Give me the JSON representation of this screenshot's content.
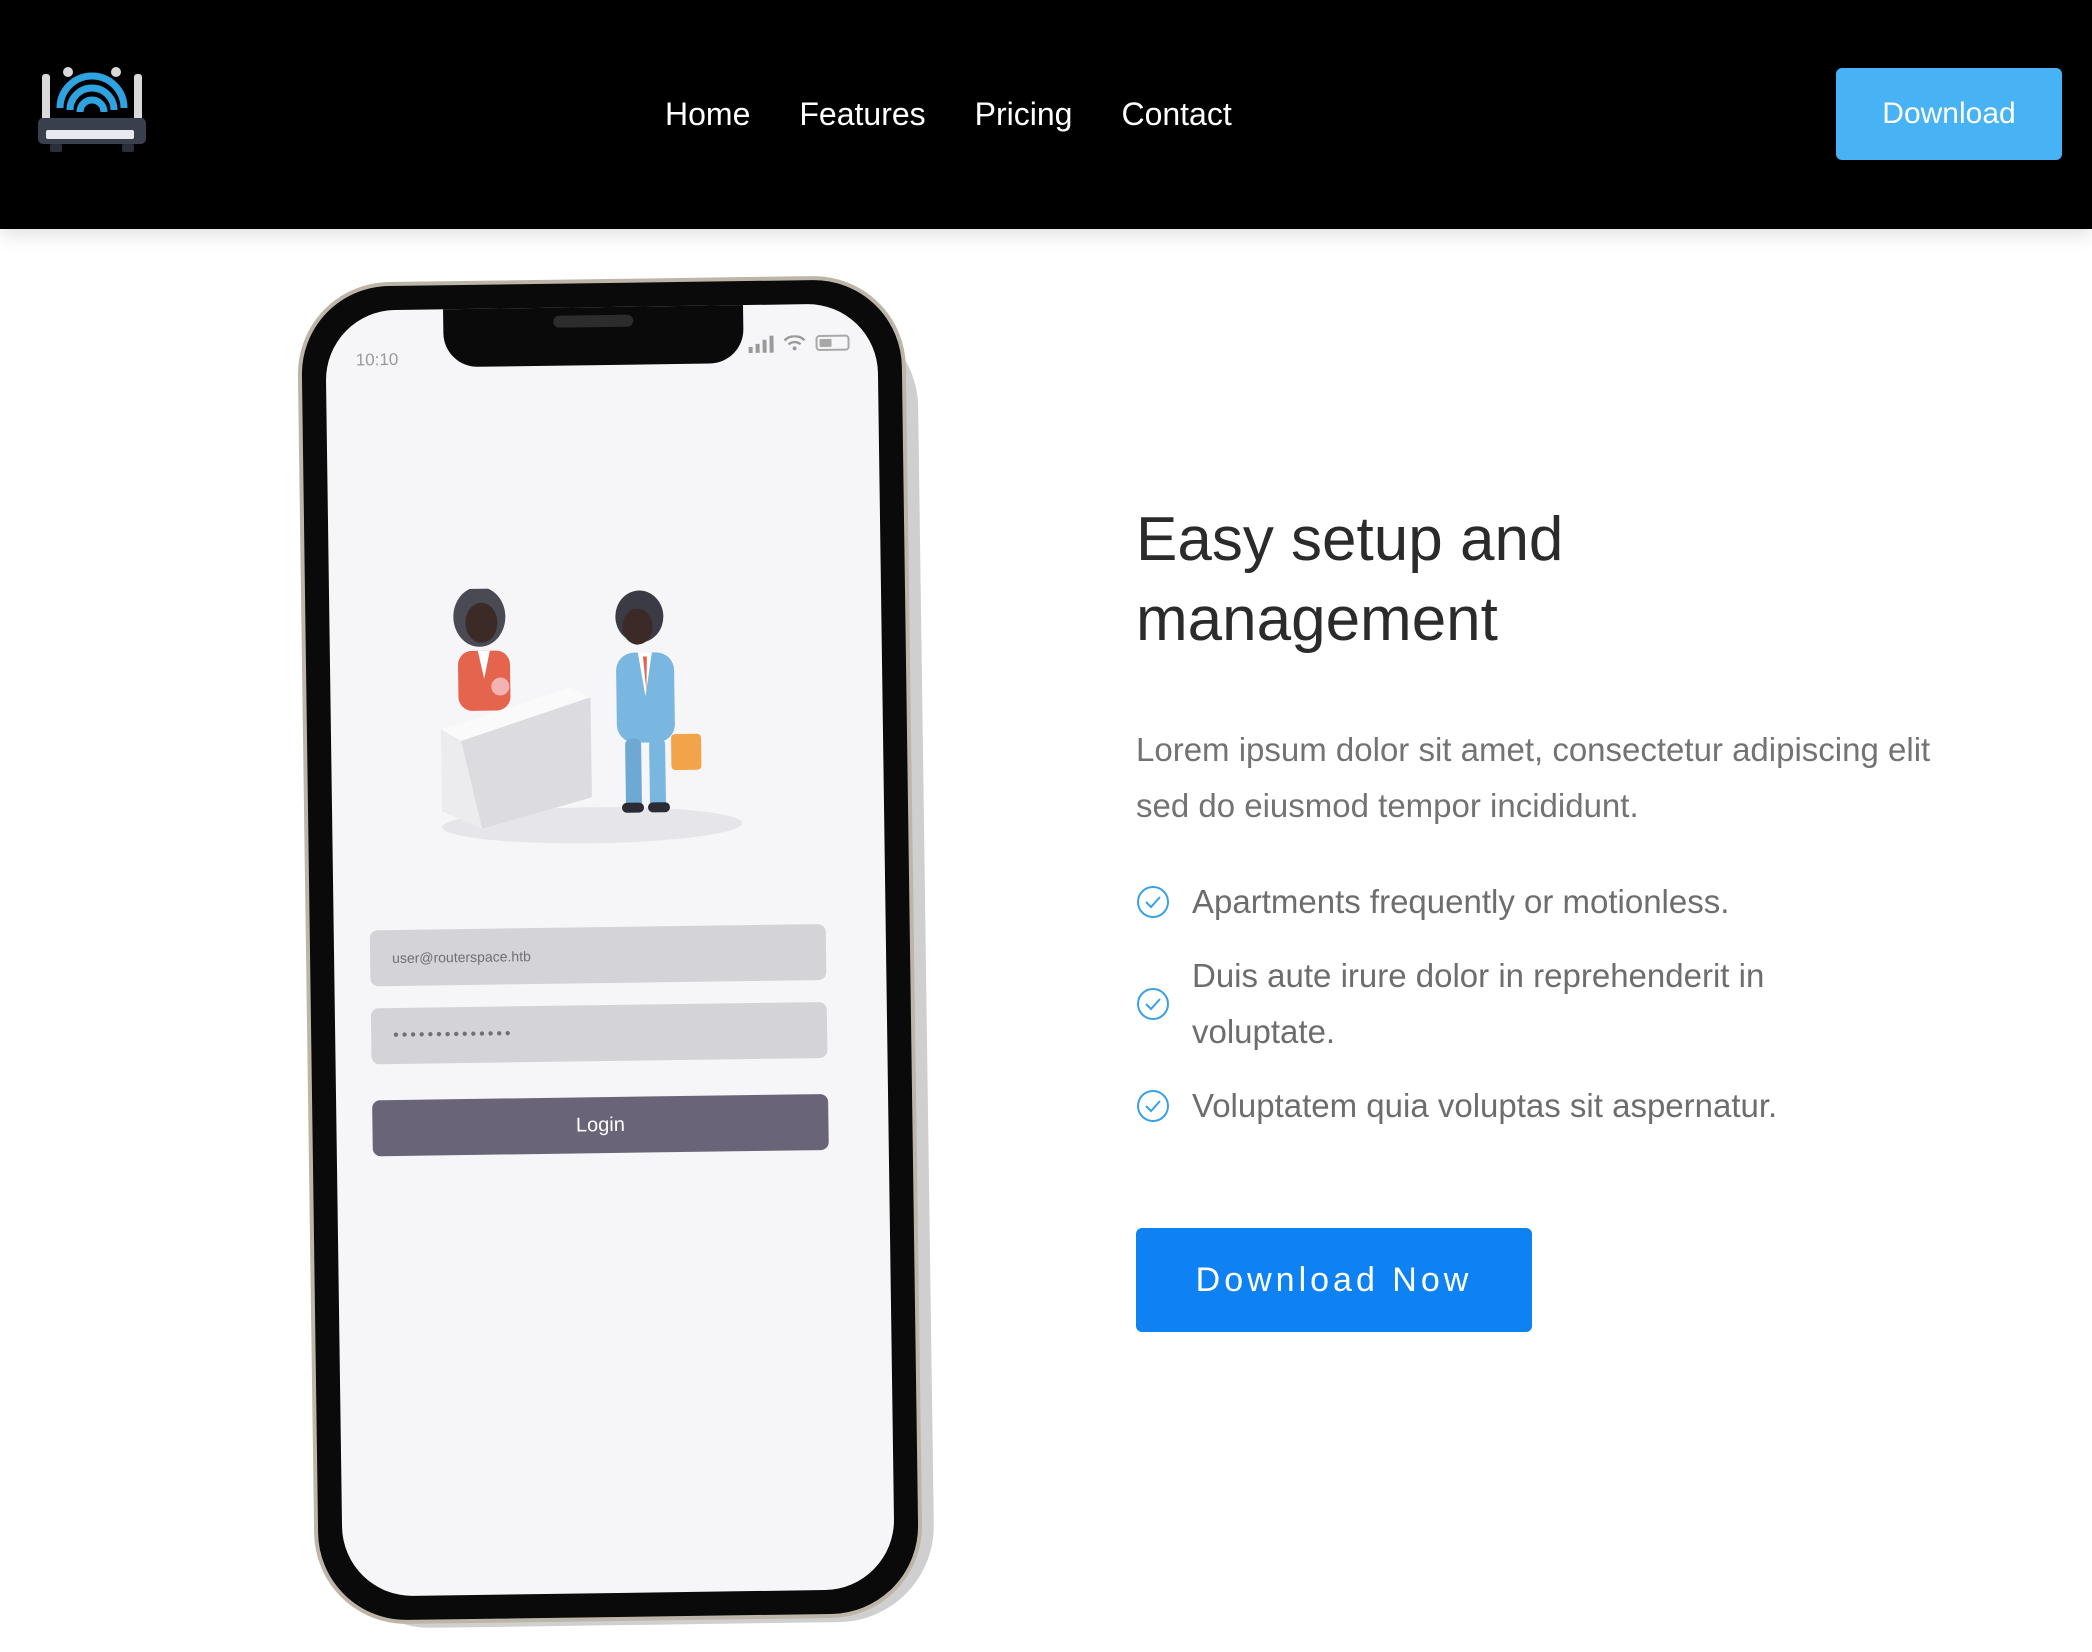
{
  "brand": {
    "logo_icon": "router-wifi-icon"
  },
  "nav": {
    "links": [
      {
        "label": "Home"
      },
      {
        "label": "Features"
      },
      {
        "label": "Pricing"
      },
      {
        "label": "Contact"
      }
    ],
    "download_label": "Download"
  },
  "phone": {
    "time": "10:10",
    "email_value": "user@routerspace.htb",
    "password_value": "••••••••••••••",
    "login_label": "Login"
  },
  "hero": {
    "headline_line1": "Easy setup and",
    "headline_line2": "management",
    "lead": "Lorem ipsum dolor sit amet, consectetur adipiscing elit sed do eiusmod tempor incididunt.",
    "features": [
      {
        "text": "Apartments frequently or motionless.",
        "icon": "check-circle-icon"
      },
      {
        "text": "Duis aute irure dolor in reprehenderit in voluptate.",
        "icon": "check-circle-icon"
      },
      {
        "text": "Voluptatem quia voluptas sit aspernatur.",
        "icon": "check-circle-icon"
      }
    ],
    "cta_label": "Download Now"
  },
  "colors": {
    "header_bg": "#000000",
    "header_button": "#47b2f4",
    "cta_button": "#0e82f2",
    "check_icon": "#3aa0e8"
  }
}
